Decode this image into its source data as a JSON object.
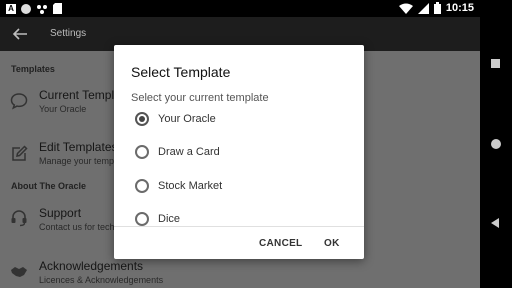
{
  "status_bar": {
    "time": "10:15",
    "icons": [
      "notification-a-icon",
      "notification-dot-icon",
      "notification-dots-icon",
      "sd-card-icon",
      "wifi-icon",
      "signal-icon",
      "battery-icon"
    ]
  },
  "toolbar": {
    "title": "Settings",
    "back_icon": "arrow-back-icon"
  },
  "sections": {
    "templates_header": "Templates",
    "about_header": "About The Oracle"
  },
  "items": {
    "current_template": {
      "title": "Current Template",
      "subtitle": "Your Oracle",
      "icon": "chat-bubble-icon"
    },
    "edit_template": {
      "title": "Edit Templates",
      "subtitle": "Manage your templates",
      "icon": "edit-icon"
    },
    "support": {
      "title": "Support",
      "subtitle": "Contact us for technical support",
      "icon": "headset-icon"
    },
    "acknowledgements": {
      "title": "Acknowledgements",
      "subtitle": "Licences & Acknowledgements",
      "icon": "handshake-icon"
    }
  },
  "dialog": {
    "title": "Select Template",
    "subtitle": "Select your current template",
    "options": [
      {
        "label": "Your Oracle",
        "selected": true
      },
      {
        "label": "Draw a Card",
        "selected": false
      },
      {
        "label": "Stock Market",
        "selected": false
      },
      {
        "label": "Dice",
        "selected": false
      }
    ],
    "cancel_label": "CANCEL",
    "ok_label": "OK"
  },
  "nav_bar": {
    "icons": [
      "recents-icon",
      "home-icon",
      "back-icon"
    ]
  },
  "colors": {
    "scrim_bg": "#6f6f6f",
    "toolbar_bg": "#1d1d1d",
    "dialog_bg": "#ffffff"
  }
}
